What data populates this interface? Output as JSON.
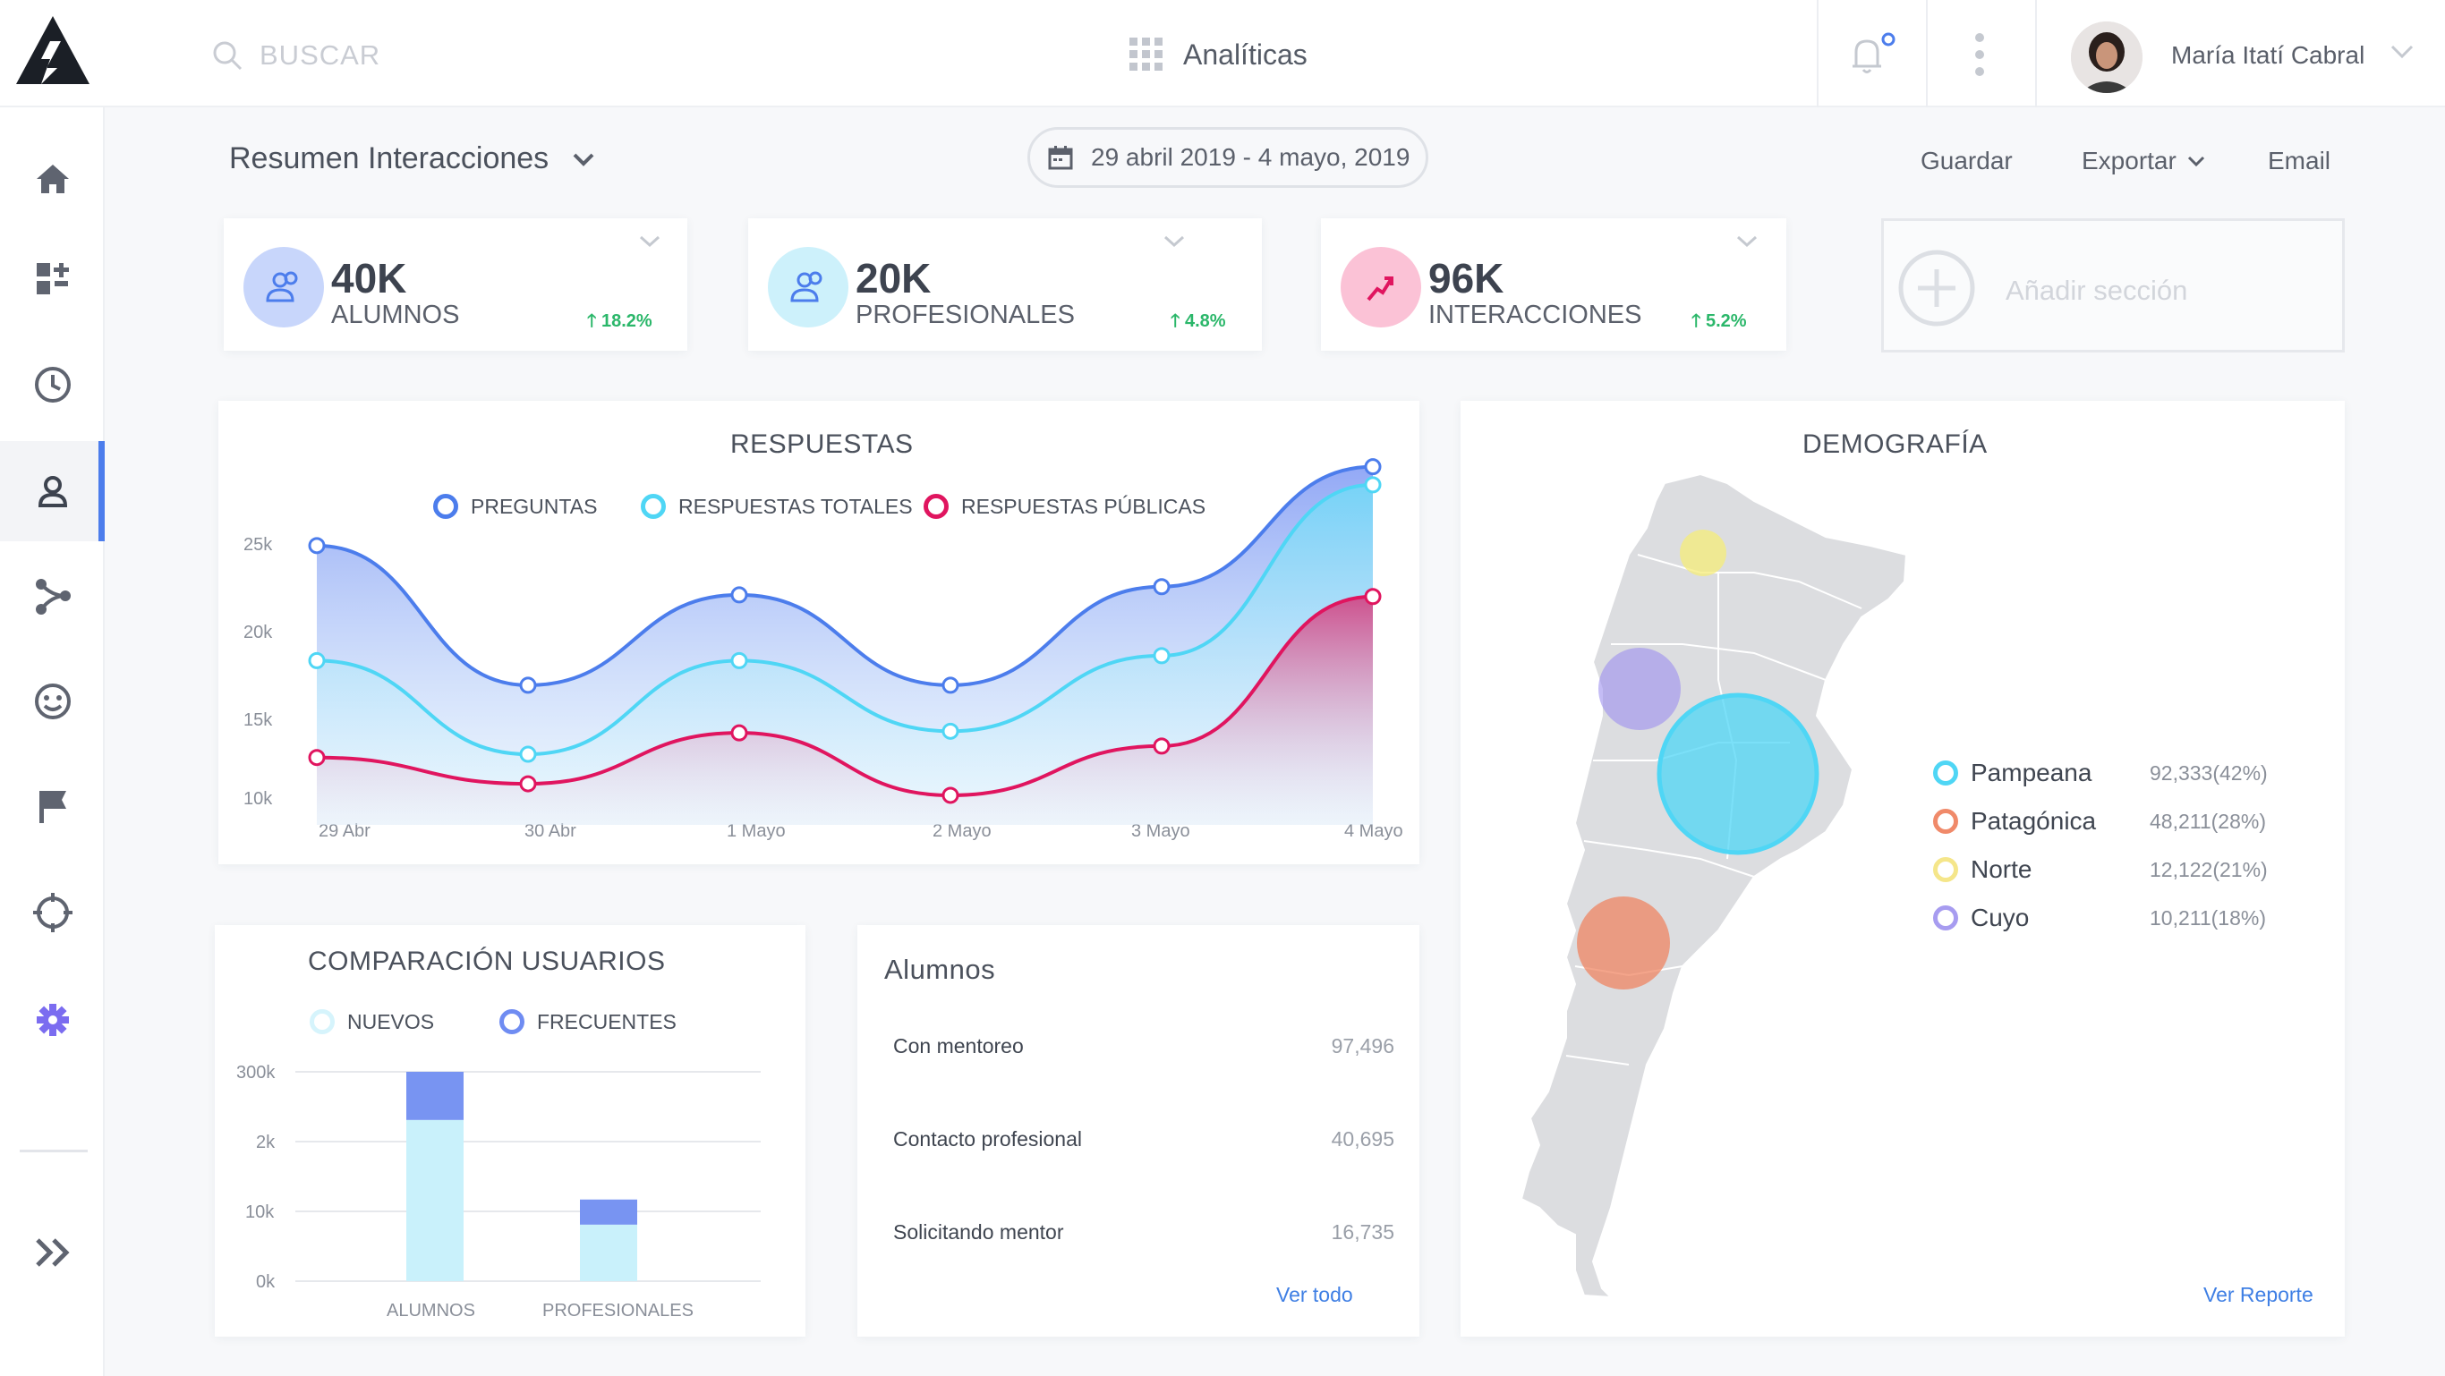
{
  "topbar": {
    "search_placeholder": "BUSCAR",
    "apps_title": "Analíticas",
    "user_name": "María Itatí Cabral"
  },
  "header": {
    "title": "Resumen Interacciones",
    "date_range": "29 abril 2019 - 4 mayo, 2019",
    "save_label": "Guardar",
    "export_label": "Exportar",
    "email_label": "Email"
  },
  "stats": [
    {
      "value": "40K",
      "label": "ALUMNOS",
      "change": "18.2%",
      "color": "#4c7dec"
    },
    {
      "value": "20K",
      "label": "PROFESIONALES",
      "change": "4.8%",
      "color": "#36c2e8"
    },
    {
      "value": "96K",
      "label": "INTERACCIONES",
      "change": "5.2%",
      "color": "#e0155f"
    }
  ],
  "add_section_label": "Añadir sección",
  "colors": {
    "accent": "#4c7dec",
    "cyan": "#4fd6f5",
    "pink": "#e0155f",
    "green": "#2bb76a"
  },
  "chart_data": [
    {
      "type": "line",
      "title": "RESPUESTAS",
      "x": [
        "29 Abr",
        "30 Abr",
        "1 Mayo",
        "2 Mayo",
        "3 Mayo",
        "4 Mayo"
      ],
      "y_ticks": [
        "25k",
        "20k",
        "15k",
        "10k"
      ],
      "ylim": [
        8000,
        30000
      ],
      "series": [
        {
          "name": "PREGUNTAS",
          "color": "#4c7dec",
          "values": [
            25000,
            16500,
            22000,
            16500,
            22500,
            29800
          ]
        },
        {
          "name": "RESPUESTAS TOTALES",
          "color": "#4fd6f5",
          "values": [
            18000,
            12300,
            18000,
            13700,
            18300,
            28700
          ]
        },
        {
          "name": "RESPUESTAS PÚBLICAS",
          "color": "#e0155f",
          "values": [
            12100,
            10500,
            13600,
            9800,
            12800,
            21900
          ]
        }
      ]
    },
    {
      "type": "bar",
      "title": "COMPARACIÓN USUARIOS",
      "categories": [
        "ALUMNOS",
        "PROFESIONALES"
      ],
      "y_ticks": [
        "300k",
        "2k",
        "10k",
        "0k"
      ],
      "series": [
        {
          "name": "NUEVOS",
          "color": "#c9f1fb",
          "values": [
            0.77,
            0.27
          ]
        },
        {
          "name": "FRECUENTES",
          "color": "#7894f2",
          "values": [
            0.23,
            0.12
          ]
        }
      ]
    }
  ],
  "alumnos": {
    "title": "Alumnos",
    "rows": [
      {
        "label": "Con mentoreo",
        "value": "97,496"
      },
      {
        "label": "Contacto profesional",
        "value": "40,695"
      },
      {
        "label": "Solicitando mentor",
        "value": "16,735"
      }
    ],
    "link": "Ver todo"
  },
  "demografia": {
    "title": "DEMOGRAFÍA",
    "legend": [
      {
        "name": "Pampeana",
        "value": "92,333(42%)",
        "color": "#4fd6f5"
      },
      {
        "name": "Patagónica",
        "value": "48,211(28%)",
        "color": "#f08a6a"
      },
      {
        "name": "Norte",
        "value": "12,122(21%)",
        "color": "#f5e68a"
      },
      {
        "name": "Cuyo",
        "value": "10,211(18%)",
        "color": "#a79cf0"
      }
    ],
    "link": "Ver Reporte"
  }
}
